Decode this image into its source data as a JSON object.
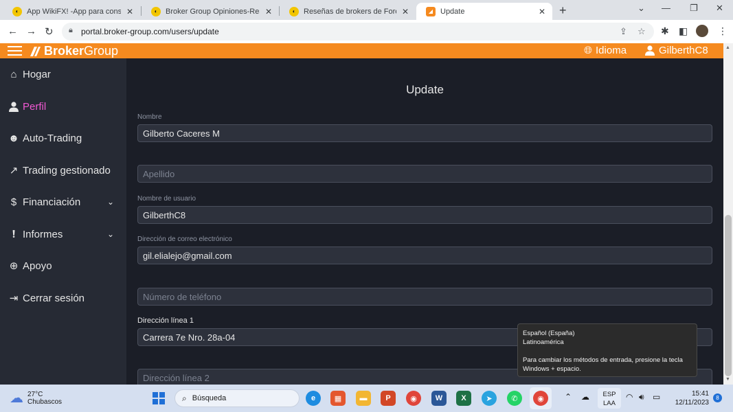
{
  "browser": {
    "tabs": [
      {
        "title": "App WikiFX! -App para consulta",
        "active": false
      },
      {
        "title": "Broker Group Opiniones-Reseña",
        "active": false
      },
      {
        "title": "Reseñas de brokers de Forex-Pla",
        "active": false
      },
      {
        "title": "Update",
        "active": true
      }
    ],
    "url": "portal.broker-group.com/users/update"
  },
  "app": {
    "logo": {
      "bold": "Broker",
      "normal": "Group"
    },
    "language_label": "Idioma",
    "username": "GilberthC8",
    "accent": "#f58a1f",
    "active_color": "#f058d2"
  },
  "sidebar": {
    "items": [
      {
        "label": "Hogar",
        "icon": "home-icon"
      },
      {
        "label": "Perfil",
        "icon": "user-icon",
        "active": true
      },
      {
        "label": "Auto-Trading",
        "icon": "brain-head-icon"
      },
      {
        "label": "Trading gestionado",
        "icon": "trend-up-icon"
      },
      {
        "label": "Financiación",
        "icon": "dollar-cycle-icon",
        "expandable": true
      },
      {
        "label": "Informes",
        "icon": "exclamation-circle-icon",
        "expandable": true
      },
      {
        "label": "Apoyo",
        "icon": "lifebuoy-icon"
      },
      {
        "label": "Cerrar sesión",
        "icon": "logout-icon"
      }
    ]
  },
  "form": {
    "title": "Update",
    "fields": [
      {
        "label": "Nombre",
        "value": "Gilberto Caceres M",
        "placeholder": ""
      },
      {
        "label": "",
        "value": "",
        "placeholder": "Apellido"
      },
      {
        "label": "Nombre de usuario",
        "value": "GilberthC8",
        "placeholder": ""
      },
      {
        "label": "Dirección de correo electrónico",
        "value": "gil.elialejo@gmail.com",
        "placeholder": ""
      },
      {
        "label": "",
        "value": "",
        "placeholder": "Número de teléfono"
      },
      {
        "label": "Dirección línea 1",
        "value": "Carrera 7e Nro. 28a-04",
        "placeholder": ""
      },
      {
        "label": "",
        "value": "",
        "placeholder": "Dirección línea 2"
      }
    ]
  },
  "tooltip": {
    "line1": "Español (España)",
    "line2": "Latinoamérica",
    "line3": "Para cambiar los métodos de entrada, presione la tecla Windows + espacio."
  },
  "taskbar": {
    "weather_temp": "27°C",
    "weather_desc": "Chubascos",
    "search_label": "Búsqueda",
    "lang_line1": "ESP",
    "lang_line2": "LAA",
    "time": "15:41",
    "date": "12/11/2023",
    "notifications": "8"
  }
}
